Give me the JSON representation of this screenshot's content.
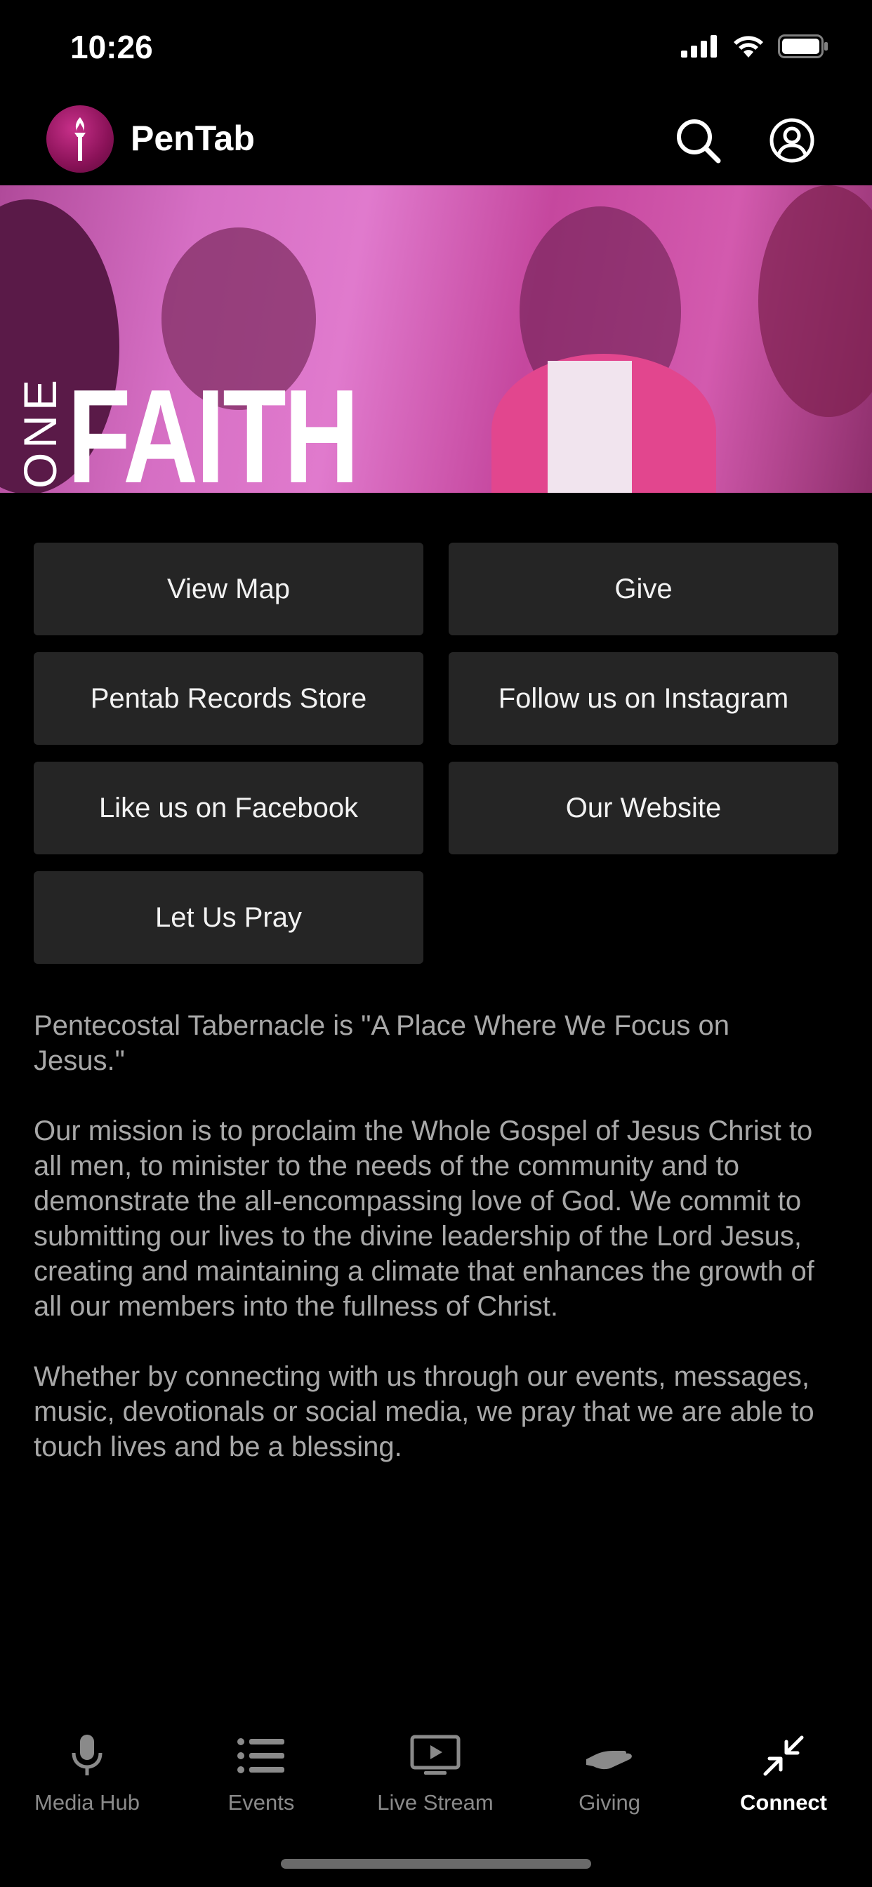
{
  "status_bar": {
    "time": "10:26"
  },
  "header": {
    "app_name": "PenTab"
  },
  "hero": {
    "word_vertical": "ONE",
    "word_main": "FAITH"
  },
  "links": [
    {
      "label": "View Map"
    },
    {
      "label": "Give"
    },
    {
      "label": "Pentab Records Store"
    },
    {
      "label": "Follow us on Instagram"
    },
    {
      "label": "Like us on Facebook"
    },
    {
      "label": "Our Website"
    },
    {
      "label": "Let Us Pray"
    }
  ],
  "description": {
    "p1": "Pentecostal Tabernacle is \"A Place Where We Focus on Jesus.\"",
    "p2": "Our mission is to proclaim the Whole Gospel of Jesus Christ to all men, to minister to the needs of the community and to demonstrate the all-encompassing love of God. We commit to submitting our lives to the divine leadership of the Lord Jesus, creating and maintaining a climate that enhances the growth of all our members into the fullness of Christ.",
    "p3": "Whether by connecting with us through our events, messages, music, devotionals or social media, we pray that we are able to touch lives and be a blessing."
  },
  "tabs": [
    {
      "label": "Media Hub",
      "icon": "microphone-icon"
    },
    {
      "label": "Events",
      "icon": "list-icon"
    },
    {
      "label": "Live Stream",
      "icon": "play-screen-icon"
    },
    {
      "label": "Giving",
      "icon": "hand-giving-icon"
    },
    {
      "label": "Connect",
      "icon": "arrows-inward-icon",
      "active": true
    }
  ],
  "colors": {
    "background": "#000000",
    "button": "#252525",
    "body_text": "#a8a8a8",
    "tab_inactive": "#8a8a8a",
    "tab_active": "#ffffff"
  }
}
